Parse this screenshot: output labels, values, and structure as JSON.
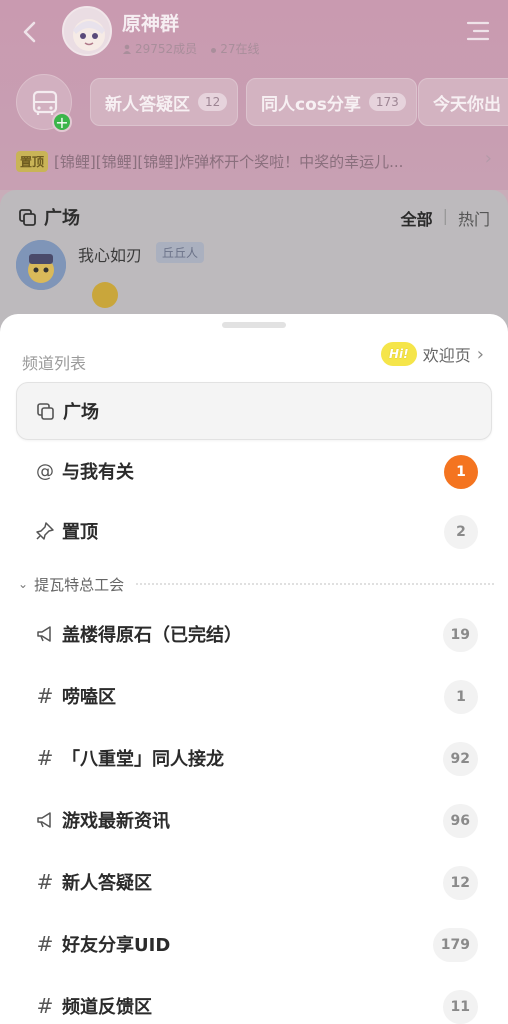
{
  "header": {
    "group_name": "原神群",
    "members": "29752成员",
    "online": "27在线",
    "avatar_caption": "paimon"
  },
  "quick_channels": [
    {
      "label": "新人答疑区",
      "count": "12"
    },
    {
      "label": "同人cos分享",
      "count": "173"
    },
    {
      "label": "今天你出"
    }
  ],
  "pinned": {
    "tag": "置顶",
    "text": "[锦鲤][锦鲤][锦鲤]炸弹杯开个奖啦！中奖的幸运儿..."
  },
  "feed": {
    "title": "广场",
    "tabs": [
      "全部",
      "热门"
    ],
    "post": {
      "user": "我心如刃",
      "tag": "丘丘人"
    }
  },
  "sheet": {
    "title": "频道列表",
    "welcome": "欢迎页",
    "hi": "Hi!",
    "top_channels": [
      {
        "icon": "square-icon",
        "label": "广场",
        "count": null
      },
      {
        "icon": "at-icon",
        "label": "与我有关",
        "count": "1"
      },
      {
        "icon": "pin-icon",
        "label": "置顶",
        "count": "2"
      }
    ],
    "section": "提瓦特总工会",
    "section_channels": [
      {
        "icon": "megaphone-icon",
        "label": "盖楼得原石（已完结）",
        "count": "19"
      },
      {
        "icon": "hash-icon",
        "label": "唠嗑区",
        "count": "1"
      },
      {
        "icon": "hash-icon",
        "label": "「八重堂」同人接龙",
        "count": "92"
      },
      {
        "icon": "megaphone-icon",
        "label": "游戏最新资讯",
        "count": "96"
      },
      {
        "icon": "hash-icon",
        "label": "新人答疑区",
        "count": "12"
      },
      {
        "icon": "hash-icon",
        "label": "好友分享UID",
        "count": "179"
      },
      {
        "icon": "hash-icon",
        "label": "频道反馈区",
        "count": "11"
      }
    ]
  },
  "colors": {
    "header_bg": "#c99ab0",
    "unread_badge": "#f47420",
    "hi_badge": "#f5e54a",
    "online_dot": "#3bb54a"
  }
}
